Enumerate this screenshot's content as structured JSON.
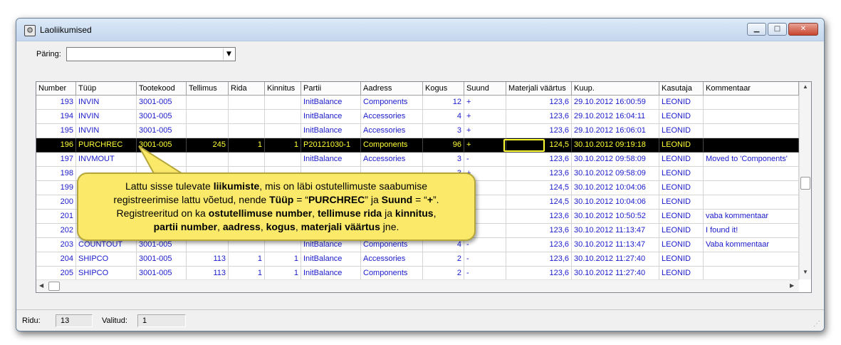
{
  "window": {
    "title": "Laoliikumised"
  },
  "query": {
    "label": "Päring:",
    "value": ""
  },
  "columns": [
    "Number",
    "Tüüp",
    "Tootekood",
    "Tellimus",
    "Rida",
    "Kinnitus",
    "Partii",
    "Aadress",
    "Kogus",
    "Suund",
    "Materjali väärtus",
    "Kuup.",
    "Kasutaja",
    "Kommentaar"
  ],
  "rows": [
    {
      "number": "193",
      "tyyp": "INVIN",
      "tootekood": "3001-005",
      "tellimus": "",
      "rida": "",
      "kinnitus": "",
      "partii": "InitBalance",
      "aadress": "Components",
      "kogus": "12",
      "suund": "+",
      "vaartus": "123,6",
      "kuup": "29.10.2012 16:00:59",
      "kasutaja": "LEONID",
      "kommentaar": ""
    },
    {
      "number": "194",
      "tyyp": "INVIN",
      "tootekood": "3001-005",
      "tellimus": "",
      "rida": "",
      "kinnitus": "",
      "partii": "InitBalance",
      "aadress": "Accessories",
      "kogus": "4",
      "suund": "+",
      "vaartus": "123,6",
      "kuup": "29.10.2012 16:04:11",
      "kasutaja": "LEONID",
      "kommentaar": ""
    },
    {
      "number": "195",
      "tyyp": "INVIN",
      "tootekood": "3001-005",
      "tellimus": "",
      "rida": "",
      "kinnitus": "",
      "partii": "InitBalance",
      "aadress": "Accessories",
      "kogus": "3",
      "suund": "+",
      "vaartus": "123,6",
      "kuup": "29.10.2012 16:06:01",
      "kasutaja": "LEONID",
      "kommentaar": ""
    },
    {
      "number": "196",
      "tyyp": "PURCHREC",
      "tootekood": "3001-005",
      "tellimus": "245",
      "rida": "1",
      "kinnitus": "1",
      "partii": "P20121030-1",
      "aadress": "Components",
      "kogus": "96",
      "suund": "+",
      "vaartus": "124,5",
      "kuup": "30.10.2012 09:19:18",
      "kasutaja": "LEONID",
      "kommentaar": ""
    },
    {
      "number": "197",
      "tyyp": "INVMOUT",
      "tootekood": "",
      "tellimus": "",
      "rida": "",
      "kinnitus": "",
      "partii": "InitBalance",
      "aadress": "Accessories",
      "kogus": "3",
      "suund": "-",
      "vaartus": "123,6",
      "kuup": "30.10.2012 09:58:09",
      "kasutaja": "LEONID",
      "kommentaar": "Moved to 'Components'"
    },
    {
      "number": "198",
      "tyyp": "",
      "tootekood": "",
      "tellimus": "",
      "rida": "",
      "kinnitus": "",
      "partii": "",
      "aadress": "",
      "kogus": "3",
      "suund": "+",
      "vaartus": "123,6",
      "kuup": "30.10.2012 09:58:09",
      "kasutaja": "LEONID",
      "kommentaar": ""
    },
    {
      "number": "199",
      "tyyp": "",
      "tootekood": "",
      "tellimus": "",
      "rida": "",
      "kinnitus": "",
      "partii": "",
      "aadress": "",
      "kogus": "",
      "suund": "",
      "vaartus": "124,5",
      "kuup": "30.10.2012 10:04:06",
      "kasutaja": "LEONID",
      "kommentaar": ""
    },
    {
      "number": "200",
      "tyyp": "",
      "tootekood": "",
      "tellimus": "",
      "rida": "",
      "kinnitus": "",
      "partii": "",
      "aadress": "",
      "kogus": "",
      "suund": "+",
      "vaartus": "124,5",
      "kuup": "30.10.2012 10:04:06",
      "kasutaja": "LEONID",
      "kommentaar": ""
    },
    {
      "number": "201",
      "tyyp": "",
      "tootekood": "",
      "tellimus": "",
      "rida": "",
      "kinnitus": "",
      "partii": "",
      "aadress": "",
      "kogus": "",
      "suund": "-",
      "vaartus": "123,6",
      "kuup": "30.10.2012 10:50:52",
      "kasutaja": "LEONID",
      "kommentaar": "vaba kommentaar"
    },
    {
      "number": "202",
      "tyyp": "",
      "tootekood": "",
      "tellimus": "",
      "rida": "",
      "kinnitus": "",
      "partii": "",
      "aadress": "",
      "kogus": "",
      "suund": "+",
      "vaartus": "123,6",
      "kuup": "30.10.2012 11:13:47",
      "kasutaja": "LEONID",
      "kommentaar": "I found it!"
    },
    {
      "number": "203",
      "tyyp": "COUNTOUT",
      "tootekood": "3001-005",
      "tellimus": "",
      "rida": "",
      "kinnitus": "",
      "partii": "InitBalance",
      "aadress": "Components",
      "kogus": "4",
      "suund": "-",
      "vaartus": "123,6",
      "kuup": "30.10.2012 11:13:47",
      "kasutaja": "LEONID",
      "kommentaar": "Vaba kommentaar"
    },
    {
      "number": "204",
      "tyyp": "SHIPCO",
      "tootekood": "3001-005",
      "tellimus": "113",
      "rida": "1",
      "kinnitus": "1",
      "partii": "InitBalance",
      "aadress": "Accessories",
      "kogus": "2",
      "suund": "-",
      "vaartus": "123,6",
      "kuup": "30.10.2012 11:27:40",
      "kasutaja": "LEONID",
      "kommentaar": ""
    },
    {
      "number": "205",
      "tyyp": "SHIPCO",
      "tootekood": "3001-005",
      "tellimus": "113",
      "rida": "1",
      "kinnitus": "1",
      "partii": "InitBalance",
      "aadress": "Components",
      "kogus": "2",
      "suund": "-",
      "vaartus": "123,6",
      "kuup": "30.10.2012 11:27:40",
      "kasutaja": "LEONID",
      "kommentaar": ""
    }
  ],
  "selected_row": 3,
  "status": {
    "rows_label": "Ridu:",
    "rows_value": "13",
    "selected_label": "Valitud:",
    "selected_value": "1"
  },
  "callout": {
    "line1_a": "Lattu sisse tulevate ",
    "line1_b": "liikumiste",
    "line1_c": ", mis on läbi ostutellimuste saabumise",
    "line2_a": "registreerimise lattu võetud, nende ",
    "line2_b": "Tüüp",
    "line2_c": " = “",
    "line2_d": "PURCHREC",
    "line2_e": "” ja ",
    "line2_f": "Suund",
    "line2_g": " = “",
    "line2_h": "+",
    "line2_i": "”.",
    "line3_a": "Registreeritud on ka ",
    "line3_b": "ostutellimuse number",
    "line3_c": ", ",
    "line3_d": "tellimuse rida",
    "line3_e": " ja ",
    "line3_f": "kinnitus",
    "line3_g": ",",
    "line4_a": "partii number",
    "line4_b": ", ",
    "line4_c": "aadress",
    "line4_d": ", ",
    "line4_e": "kogus",
    "line4_f": ", ",
    "line4_g": "materjali väärtus",
    "line4_h": " jne."
  },
  "colors": {
    "cell_text": "#1a1acc",
    "selected_bg": "#000000",
    "selected_text": "#ffff33",
    "callout_bg": "#fbe96a"
  }
}
